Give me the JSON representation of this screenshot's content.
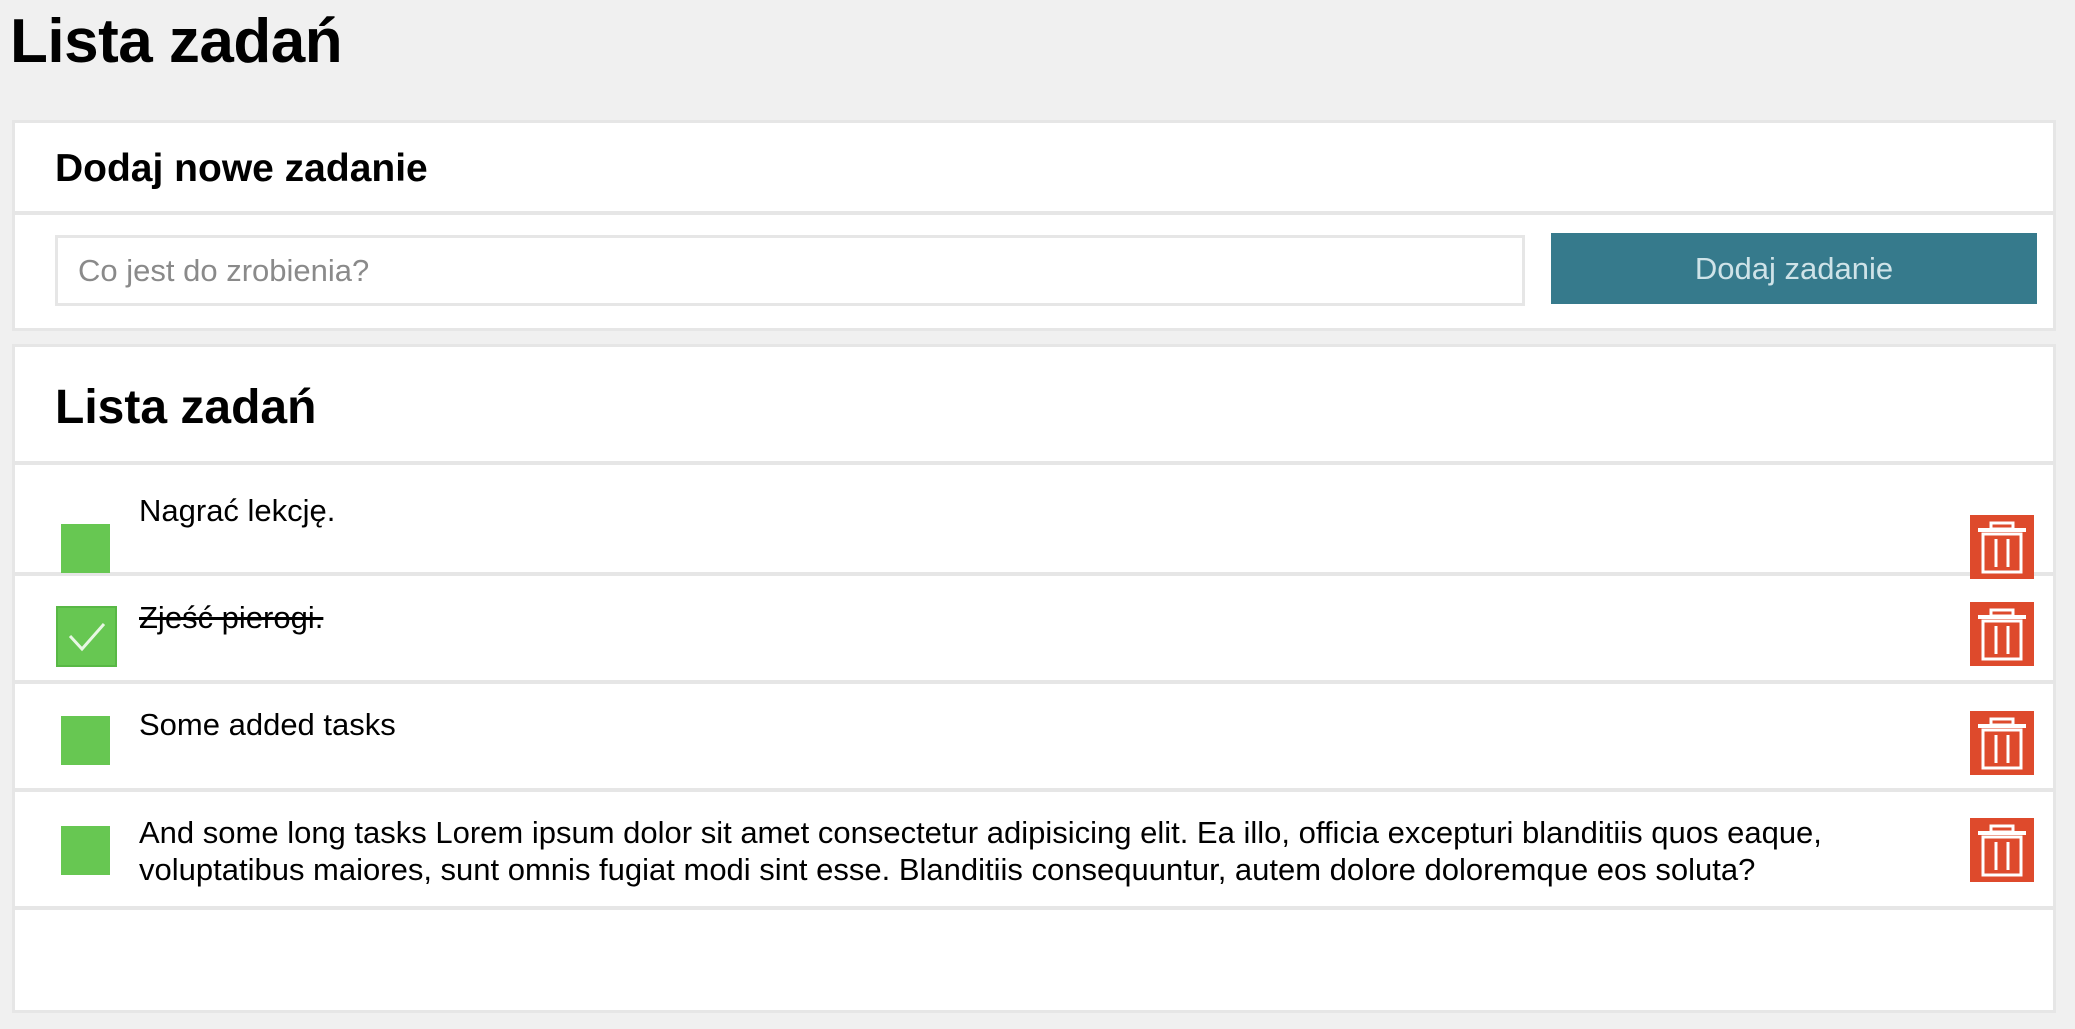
{
  "page": {
    "title": "Lista zadań"
  },
  "add_panel": {
    "title": "Dodaj nowe zadanie",
    "input_placeholder": "Co jest do zrobienia?",
    "input_value": "",
    "button_label": "Dodaj zadanie"
  },
  "list_panel": {
    "title": "Lista zadań",
    "tasks": [
      {
        "text": "Nagrać lekcję.",
        "completed": false
      },
      {
        "text": "Zjeść pierogi.",
        "completed": true
      },
      {
        "text": "Some added tasks",
        "completed": false
      },
      {
        "text": "And some long tasks Lorem ipsum dolor sit amet consectetur adipisicing elit. Ea illo, officia excepturi blanditiis quos eaque, voluptatibus maiores, sunt omnis fugiat modi sint esse. Blanditiis consequuntur, autem dolore doloremque eos soluta?",
        "completed": false
      }
    ]
  },
  "icons": {
    "checkbox": "checkbox-icon",
    "checkmark": "checkmark-icon",
    "delete": "trash-icon"
  },
  "colors": {
    "background": "#f0f0f0",
    "button": "#367a8c",
    "button_text": "#cfe3e8",
    "checkbox": "#67c752",
    "delete": "#de4a2c",
    "border": "#e6e6e6"
  }
}
